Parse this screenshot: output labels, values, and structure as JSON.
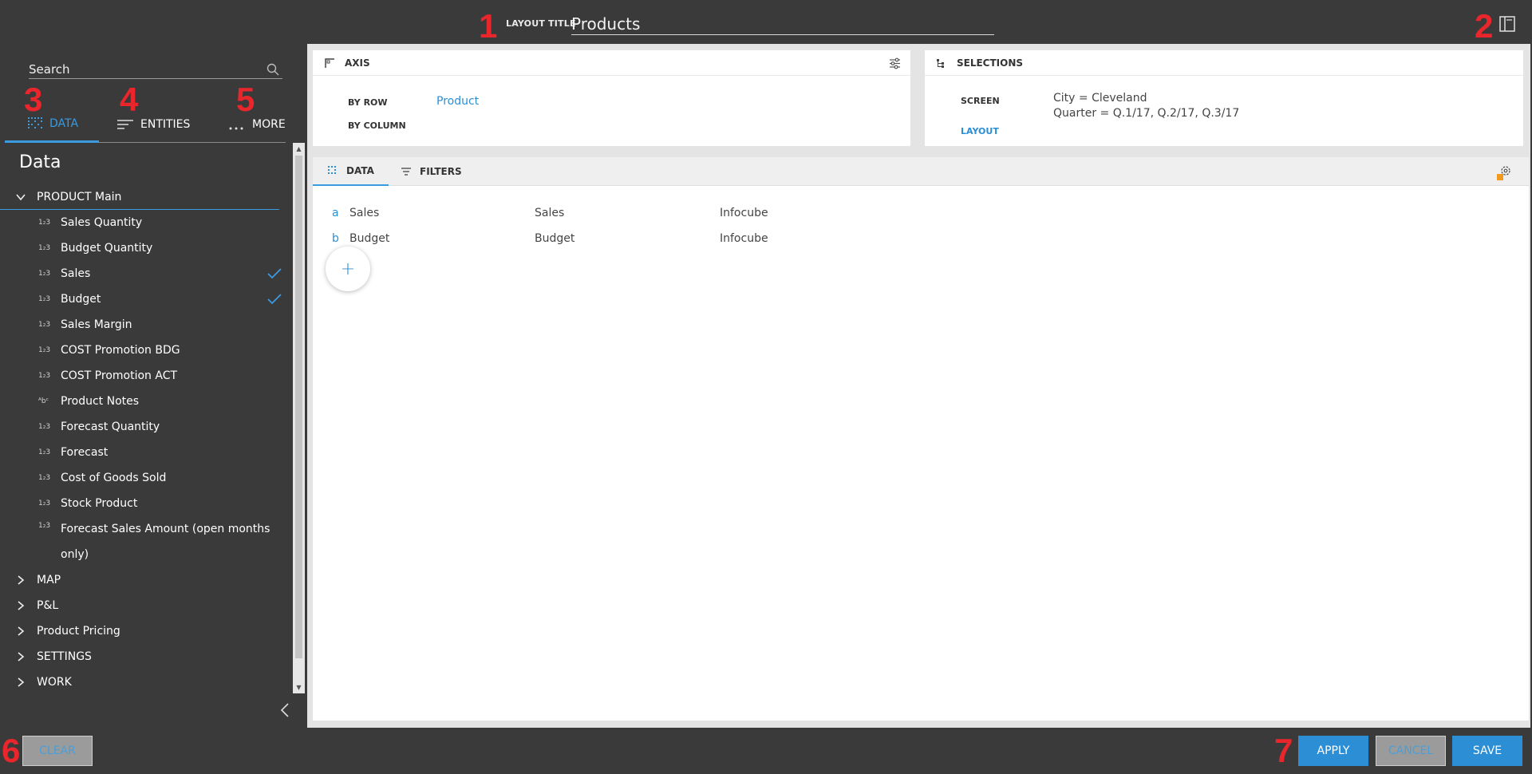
{
  "annotations": [
    "1",
    "2",
    "3",
    "4",
    "5",
    "6",
    "7"
  ],
  "header": {
    "layout_title_label": "LAYOUT TITLE",
    "layout_title_value": "Products"
  },
  "sidebar": {
    "search_placeholder": "Search",
    "tabs": [
      {
        "label": "DATA",
        "icon": "grid-icon",
        "active": true
      },
      {
        "label": "ENTITIES",
        "icon": "list-icon",
        "active": false
      },
      {
        "label": "MORE",
        "icon": "ellipsis-icon",
        "active": false
      }
    ],
    "heading": "Data",
    "open_group": "PRODUCT Main",
    "items": [
      {
        "type": "1₂3",
        "label": "Sales Quantity",
        "checked": false
      },
      {
        "type": "1₂3",
        "label": "Budget Quantity",
        "checked": false
      },
      {
        "type": "1₂3",
        "label": "Sales",
        "checked": true
      },
      {
        "type": "1₂3",
        "label": "Budget",
        "checked": true
      },
      {
        "type": "1₂3",
        "label": "Sales Margin",
        "checked": false
      },
      {
        "type": "1₂3",
        "label": "COST Promotion BDG",
        "checked": false
      },
      {
        "type": "1₂3",
        "label": "COST Promotion ACT",
        "checked": false
      },
      {
        "type": "ᴬbᶜ",
        "label": "Product Notes",
        "checked": false
      },
      {
        "type": "1₂3",
        "label": "Forecast Quantity",
        "checked": false
      },
      {
        "type": "1₂3",
        "label": "Forecast",
        "checked": false
      },
      {
        "type": "1₂3",
        "label": "Cost of Goods Sold",
        "checked": false
      },
      {
        "type": "1₂3",
        "label": "Stock Product",
        "checked": false
      },
      {
        "type": "1₂3",
        "label": "Forecast Sales Amount (open months only)",
        "checked": false
      }
    ],
    "closed_groups": [
      "MAP",
      "P&L",
      "Product Pricing",
      "SETTINGS",
      "WORK"
    ]
  },
  "axis": {
    "title": "AXIS",
    "by_row_label": "BY ROW",
    "by_row_value": "Product",
    "by_column_label": "BY COLUMN"
  },
  "selections": {
    "title": "SELECTIONS",
    "screen_label": "SCREEN",
    "screen_line1": "City = Cleveland",
    "screen_line2": "Quarter = Q.1/17, Q.2/17, Q.3/17",
    "layout_label": "LAYOUT"
  },
  "data_panel": {
    "tabs": [
      "DATA",
      "FILTERS"
    ],
    "rows": [
      {
        "letter": "a",
        "name": "Sales",
        "desc": "Sales",
        "source": "Infocube"
      },
      {
        "letter": "b",
        "name": "Budget",
        "desc": "Budget",
        "source": "Infocube"
      }
    ],
    "add_symbol": "+"
  },
  "footer": {
    "clear": "CLEAR",
    "apply": "APPLY",
    "cancel": "CANCEL",
    "save": "SAVE"
  },
  "colors": {
    "accent": "#2c8fd6",
    "background": "#3a3a3a",
    "annotation": "#e8262b"
  }
}
